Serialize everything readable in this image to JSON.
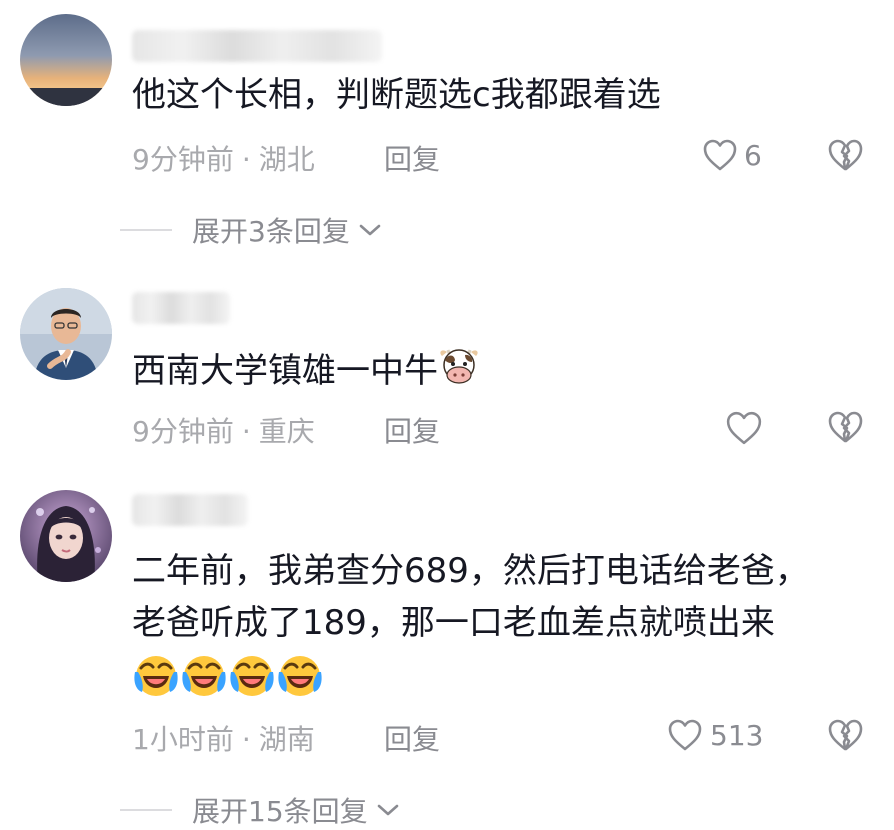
{
  "comments": [
    {
      "text": "他这个长相，判断题选c我都跟着选",
      "time": "9分钟前",
      "location": "湖北",
      "reply_label": "回复",
      "likes": "6",
      "expand_label": "展开3条回复"
    },
    {
      "text": "西南大学镇雄一中牛",
      "time": "9分钟前",
      "location": "重庆",
      "reply_label": "回复",
      "likes": ""
    },
    {
      "text_line1": "二年前，我弟查分689，然后打电话给老爸，",
      "text_line2": "老爸听成了189，那一口老血差点就喷出来",
      "time": "1小时前",
      "location": "湖南",
      "reply_label": "回复",
      "likes": "513",
      "expand_label": "展开15条回复"
    }
  ],
  "separator": "·",
  "icons": {
    "like": "heart-outline-icon",
    "dislike": "broken-heart-icon",
    "expand": "chevron-down-icon"
  },
  "colors": {
    "text": "#161823",
    "meta": "#a8a9ad",
    "action": "#8a8b91"
  }
}
